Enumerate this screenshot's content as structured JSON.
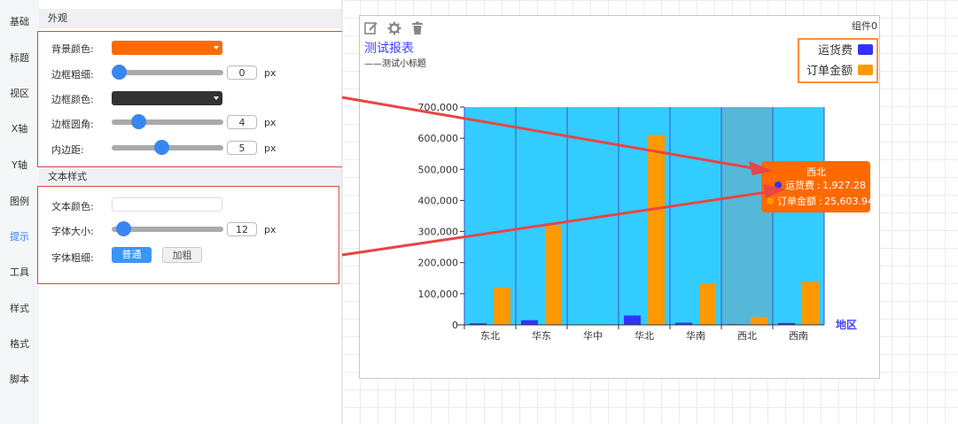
{
  "nav": [
    "基础",
    "标题",
    "视区",
    "X轴",
    "Y轴",
    "图例",
    "提示",
    "工具",
    "样式",
    "格式",
    "脚本"
  ],
  "nav_active": "提示",
  "appearance": {
    "title": "外观",
    "bg_color_label": "背景颜色:",
    "bg_color": "#ff6a00",
    "border_width_label": "边框粗细:",
    "border_width": "0",
    "border_color_label": "边框颜色:",
    "border_color": "#333333",
    "border_radius_label": "边框圆角:",
    "border_radius": "4",
    "padding_label": "内边距:",
    "padding": "5",
    "unit": "px"
  },
  "text_style": {
    "title": "文本样式",
    "color_label": "文本颜色:",
    "font_size_label": "字体大小:",
    "font_size": "12",
    "unit": "px",
    "weight_label": "字体粗细:",
    "normal_label": "普通",
    "bold_label": "加粗"
  },
  "component": {
    "name": "组件0",
    "toolbar_icons": [
      "edit-icon",
      "gear-icon",
      "trash-icon"
    ]
  },
  "tooltip": {
    "title": "西北",
    "rows": [
      {
        "label": "运货费",
        "value": "1,927.28",
        "color": "#3333ff"
      },
      {
        "label": "订单金额",
        "value": "25,603.94",
        "color": "#ff9900"
      }
    ],
    "bg_color": "#ff6a00"
  },
  "chart_data": {
    "type": "bar",
    "title": "测试报表",
    "subtitle": "——测试小标题",
    "xlabel": "地区",
    "ylabel": "",
    "ylim": [
      0,
      700000
    ],
    "yticks": [
      "0",
      "100,000",
      "200,000",
      "300,000",
      "400,000",
      "500,000",
      "600,000",
      "700,000"
    ],
    "categories": [
      "东北",
      "华东",
      "华中",
      "华北",
      "华南",
      "西北",
      "西南"
    ],
    "series": [
      {
        "name": "运货费",
        "color": "#3333ff",
        "values": [
          5000,
          15000,
          500,
          30000,
          7000,
          1927.28,
          6000
        ]
      },
      {
        "name": "订单金额",
        "color": "#ff9900",
        "values": [
          120000,
          320000,
          1000,
          610000,
          132000,
          25603.94,
          140000
        ]
      }
    ],
    "plot_bg": "#33ccff",
    "highlight_category": "西北",
    "legend_position": "top-right",
    "grid": true
  }
}
